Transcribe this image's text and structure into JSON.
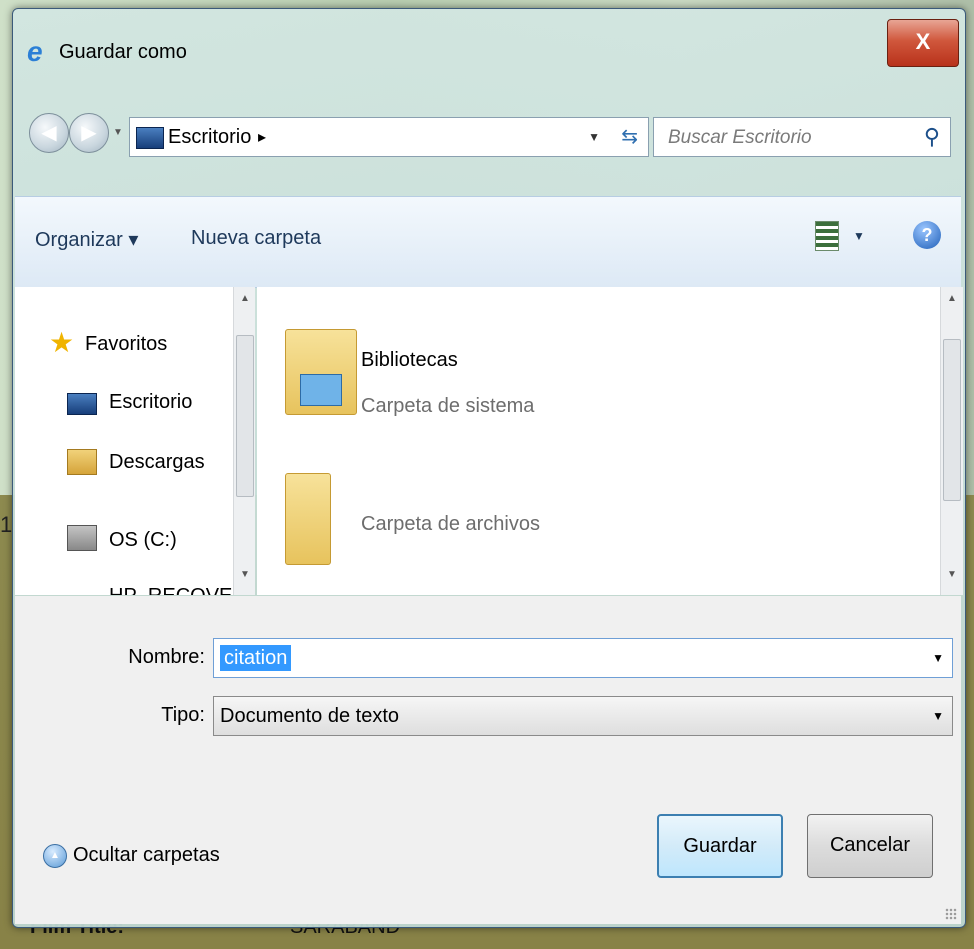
{
  "dialog": {
    "title": "Guardar como",
    "close_label": "X"
  },
  "address": {
    "location": "Escritorio",
    "search_placeholder": "Buscar Escritorio"
  },
  "toolbar": {
    "organize_label": "Organizar ▾",
    "new_folder_label": "Nueva carpeta",
    "help_label": "?"
  },
  "navigation": {
    "items": [
      {
        "label": "Favoritos",
        "icon": "star-icon"
      },
      {
        "label": "Escritorio",
        "icon": "desktop-icon"
      },
      {
        "label": "Descargas",
        "icon": "downloads-icon"
      },
      {
        "label": "OS (C:)",
        "icon": "drive-icon"
      },
      {
        "label": "HP_RECOVERY (",
        "icon": "drive-icon"
      }
    ]
  },
  "files": [
    {
      "name": "Bibliotecas",
      "type": "Carpeta de sistema",
      "icon": "library-folder-icon"
    },
    {
      "name": "",
      "type": "Carpeta de archivos",
      "icon": "folder-icon"
    }
  ],
  "form": {
    "name_label": "Nombre:",
    "name_value": "citation",
    "type_label": "Tipo:",
    "type_value": "Documento de texto"
  },
  "buttons": {
    "hide_folders": "Ocultar carpetas",
    "save": "Guardar",
    "cancel": "Cancelar"
  },
  "background": {
    "left_digit": "1",
    "film_title_label": "Film Title:",
    "film_title_value": "SARABAND"
  },
  "colors": {
    "selection": "#3399ff",
    "close_button": "#c8432a",
    "link_text": "#1e395b"
  }
}
